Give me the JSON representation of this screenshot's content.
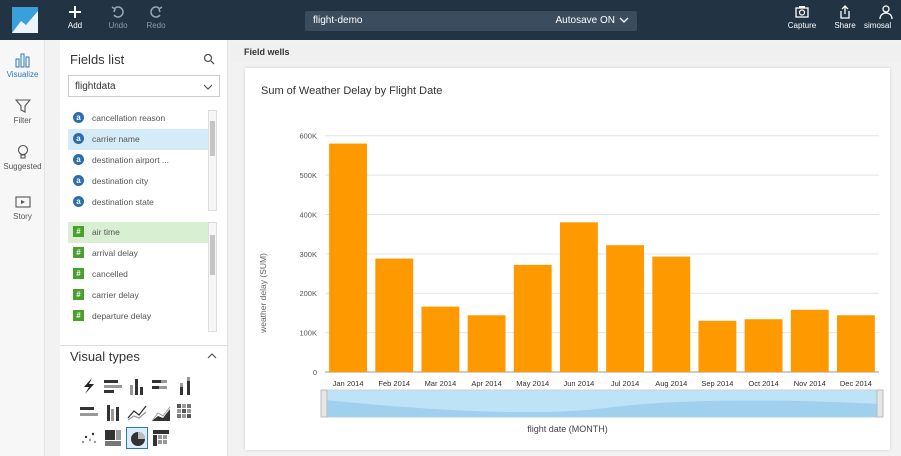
{
  "toolbar": {
    "add_label": "Add",
    "undo_label": "Undo",
    "redo_label": "Redo",
    "document_name": "flight-demo",
    "autosave_label": "Autosave ON",
    "capture_label": "Capture",
    "share_label": "Share",
    "user_label": "simosal"
  },
  "rail": {
    "items": [
      {
        "label": "Visualize",
        "icon": "bar-chart-icon",
        "active": true
      },
      {
        "label": "Filter",
        "icon": "filter-icon",
        "active": false
      },
      {
        "label": "Suggested",
        "icon": "lightbulb-icon",
        "active": false
      },
      {
        "label": "Story",
        "icon": "play-icon",
        "active": false
      }
    ]
  },
  "fields": {
    "title": "Fields list",
    "dataset": "flightdata",
    "dimensions": [
      {
        "name": "cancellation reason",
        "selected": false
      },
      {
        "name": "carrier name",
        "selected": true
      },
      {
        "name": "destination airport ...",
        "selected": false
      },
      {
        "name": "destination city",
        "selected": false
      },
      {
        "name": "destination state",
        "selected": false
      }
    ],
    "measures": [
      {
        "name": "air time",
        "selected": true
      },
      {
        "name": "arrival delay",
        "selected": false
      },
      {
        "name": "cancelled",
        "selected": false
      },
      {
        "name": "carrier delay",
        "selected": false
      },
      {
        "name": "departure delay",
        "selected": false
      }
    ],
    "dimension_icon": "a",
    "measure_icon": "#"
  },
  "visual_types": {
    "title": "Visual types",
    "selected": "pie-chart-icon"
  },
  "main": {
    "wells_label": "Field wells"
  },
  "chart_data": {
    "type": "bar",
    "title": "Sum of Weather Delay by Flight Date",
    "xlabel": "flight date (MONTH)",
    "ylabel": "weather delay (SUM)",
    "categories": [
      "Jan 2014",
      "Feb 2014",
      "Mar 2014",
      "Apr 2014",
      "May 2014",
      "Jun 2014",
      "Jul 2014",
      "Aug 2014",
      "Sep 2014",
      "Oct 2014",
      "Nov 2014",
      "Dec 2014"
    ],
    "values": [
      580000,
      288000,
      166000,
      144000,
      272000,
      380000,
      322000,
      293000,
      130000,
      134000,
      158000,
      144000
    ],
    "ylim": [
      0,
      650000
    ],
    "yticks": [
      0,
      100000,
      200000,
      300000,
      400000,
      500000,
      600000
    ],
    "ytick_labels": [
      "0",
      "100K",
      "200K",
      "300K",
      "400K",
      "500K",
      "600K"
    ],
    "bar_color": "#ff9900",
    "grid": true
  }
}
